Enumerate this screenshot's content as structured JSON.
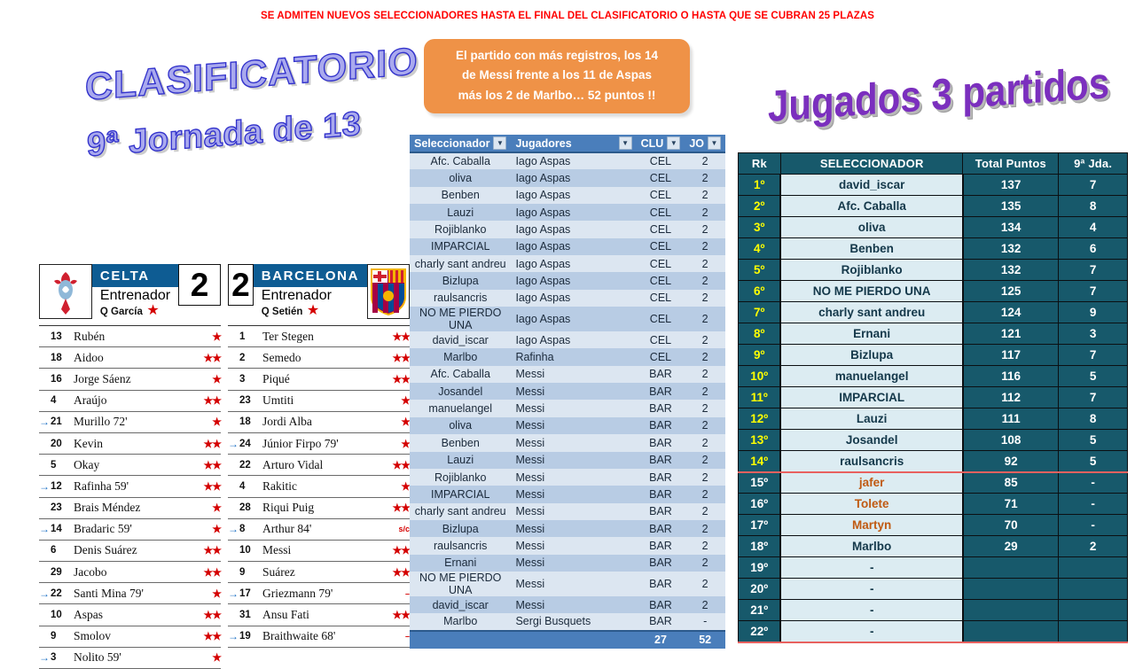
{
  "banner": {
    "text": "SE ADMITEN NUEVOS SELECCIONADORES  HASTA EL FINAL DEL CLASIFICATORIO  O HASTA QUE SE CUBRAN 25 PLAZAS"
  },
  "callout": {
    "line1": "El partido con más registros,  los 14",
    "line2": "de Messi frente a los 11 de Aspas",
    "line3": "más los 2 de Marlbo… 52 puntos !!"
  },
  "titles": {
    "clasificatorio": "CLASIFICATORIO",
    "jornada": "9ª Jornada de 13",
    "jugados": "Jugados 3 partidos"
  },
  "match": {
    "home": {
      "name": "CELTA",
      "score": "2",
      "coach_label": "Entrenador",
      "coach": "Q García",
      "coach_star": "★",
      "crest": "celta-crest"
    },
    "away": {
      "name": "BARCELONA",
      "score": "2",
      "coach_label": "Entrenador",
      "coach": "Q Setién",
      "coach_star": "★",
      "crest": "barcelona-crest"
    },
    "home_players": [
      {
        "sub": "",
        "num": "13",
        "name": "Rubén",
        "rating": "★"
      },
      {
        "sub": "",
        "num": "18",
        "name": "Aidoo",
        "rating": "★★"
      },
      {
        "sub": "",
        "num": "16",
        "name": "Jorge Sáenz",
        "rating": "★"
      },
      {
        "sub": "",
        "num": "4",
        "name": "Araújo",
        "rating": "★★"
      },
      {
        "sub": "→",
        "num": "21",
        "name": "Murillo 72'",
        "rating": "★"
      },
      {
        "sub": "",
        "num": "20",
        "name": "Kevin",
        "rating": "★★"
      },
      {
        "sub": "",
        "num": "5",
        "name": "Okay",
        "rating": "★★"
      },
      {
        "sub": "→",
        "num": "12",
        "name": "Rafinha 59'",
        "rating": "★★"
      },
      {
        "sub": "",
        "num": "23",
        "name": "Brais Méndez",
        "rating": "★"
      },
      {
        "sub": "→",
        "num": "14",
        "name": "Bradaric 59'",
        "rating": "★"
      },
      {
        "sub": "",
        "num": "6",
        "name": "Denis Suárez",
        "rating": "★★"
      },
      {
        "sub": "",
        "num": "29",
        "name": "Jacobo",
        "rating": "★★"
      },
      {
        "sub": "→",
        "num": "22",
        "name": "Santi Mina 79'",
        "rating": "★"
      },
      {
        "sub": "",
        "num": "10",
        "name": "Aspas",
        "rating": "★★"
      },
      {
        "sub": "",
        "num": "9",
        "name": "Smolov",
        "rating": "★★"
      },
      {
        "sub": "→",
        "num": "3",
        "name": "Nolito 59'",
        "rating": "★"
      }
    ],
    "away_players": [
      {
        "sub": "",
        "num": "1",
        "name": "Ter Stegen",
        "rating": "★★"
      },
      {
        "sub": "",
        "num": "2",
        "name": "Semedo",
        "rating": "★★"
      },
      {
        "sub": "",
        "num": "3",
        "name": "Piqué",
        "rating": "★★"
      },
      {
        "sub": "",
        "num": "23",
        "name": "Umtiti",
        "rating": "★"
      },
      {
        "sub": "",
        "num": "18",
        "name": "Jordi Alba",
        "rating": "★"
      },
      {
        "sub": "→",
        "num": "24",
        "name": "Júnior Firpo 79'",
        "rating": "★"
      },
      {
        "sub": "",
        "num": "22",
        "name": "Arturo Vidal",
        "rating": "★★"
      },
      {
        "sub": "",
        "num": "4",
        "name": "Rakitic",
        "rating": "★"
      },
      {
        "sub": "",
        "num": "28",
        "name": "Riqui Puig",
        "rating": "★★"
      },
      {
        "sub": "→",
        "num": "8",
        "name": "Arthur 84'",
        "rating": "s/c"
      },
      {
        "sub": "",
        "num": "10",
        "name": "Messi",
        "rating": "★★"
      },
      {
        "sub": "",
        "num": "9",
        "name": "Suárez",
        "rating": "★★"
      },
      {
        "sub": "→",
        "num": "17",
        "name": "Griezmann 79'",
        "rating": "–"
      },
      {
        "sub": "",
        "num": "31",
        "name": "Ansu Fati",
        "rating": "★★"
      },
      {
        "sub": "→",
        "num": "19",
        "name": "Braithwaite 68'",
        "rating": "–"
      }
    ]
  },
  "picks_table": {
    "headers": [
      "Seleccionador",
      "Jugadores",
      "CLU",
      "JO"
    ],
    "header_icons": [
      "filter-icon",
      "chevron-down-icon",
      "filter-icon",
      "chevron-down-icon"
    ],
    "rows": [
      [
        "Afc. Caballa",
        "Iago Aspas",
        "CEL",
        "2"
      ],
      [
        "oliva",
        "Iago Aspas",
        "CEL",
        "2"
      ],
      [
        "Benben",
        "Iago Aspas",
        "CEL",
        "2"
      ],
      [
        "Lauzi",
        "Iago Aspas",
        "CEL",
        "2"
      ],
      [
        "Rojiblanko",
        "Iago Aspas",
        "CEL",
        "2"
      ],
      [
        "IMPARCIAL",
        "Iago Aspas",
        "CEL",
        "2"
      ],
      [
        "charly sant andreu",
        "Iago Aspas",
        "CEL",
        "2"
      ],
      [
        "Bizlupa",
        "Iago Aspas",
        "CEL",
        "2"
      ],
      [
        "raulsancris",
        "Iago Aspas",
        "CEL",
        "2"
      ],
      [
        "NO ME PIERDO UNA",
        "Iago Aspas",
        "CEL",
        "2"
      ],
      [
        "david_iscar",
        "Iago Aspas",
        "CEL",
        "2"
      ],
      [
        "Marlbo",
        "Rafinha",
        "CEL",
        "2"
      ],
      [
        "Afc. Caballa",
        "Messi",
        "BAR",
        "2"
      ],
      [
        "Josandel",
        "Messi",
        "BAR",
        "2"
      ],
      [
        "manuelangel",
        "Messi",
        "BAR",
        "2"
      ],
      [
        "oliva",
        "Messi",
        "BAR",
        "2"
      ],
      [
        "Benben",
        "Messi",
        "BAR",
        "2"
      ],
      [
        "Lauzi",
        "Messi",
        "BAR",
        "2"
      ],
      [
        "Rojiblanko",
        "Messi",
        "BAR",
        "2"
      ],
      [
        "IMPARCIAL",
        "Messi",
        "BAR",
        "2"
      ],
      [
        "charly sant andreu",
        "Messi",
        "BAR",
        "2"
      ],
      [
        "Bizlupa",
        "Messi",
        "BAR",
        "2"
      ],
      [
        "raulsancris",
        "Messi",
        "BAR",
        "2"
      ],
      [
        "Ernani",
        "Messi",
        "BAR",
        "2"
      ],
      [
        "NO ME PIERDO UNA",
        "Messi",
        "BAR",
        "2"
      ],
      [
        "david_iscar",
        "Messi",
        "BAR",
        "2"
      ],
      [
        "Marlbo",
        "Sergi Busquets",
        "BAR",
        "-"
      ]
    ],
    "totals": [
      "",
      "",
      "27",
      "52"
    ]
  },
  "ranking": {
    "headers": [
      "Rk",
      "SELECCIONADOR",
      "Total Puntos",
      "9ª Jda."
    ],
    "rows": [
      {
        "rk": "1º",
        "name": "david_iscar",
        "total": "137",
        "jda": "7"
      },
      {
        "rk": "2º",
        "name": "Afc. Caballa",
        "total": "135",
        "jda": "8"
      },
      {
        "rk": "3º",
        "name": "oliva",
        "total": "134",
        "jda": "4"
      },
      {
        "rk": "4º",
        "name": "Benben",
        "total": "132",
        "jda": "6"
      },
      {
        "rk": "5º",
        "name": "Rojiblanko",
        "total": "132",
        "jda": "7"
      },
      {
        "rk": "6º",
        "name": "NO ME PIERDO UNA",
        "total": "125",
        "jda": "7"
      },
      {
        "rk": "7º",
        "name": "charly sant andreu",
        "total": "124",
        "jda": "9"
      },
      {
        "rk": "8º",
        "name": "Ernani",
        "total": "121",
        "jda": "3"
      },
      {
        "rk": "9º",
        "name": "Bizlupa",
        "total": "117",
        "jda": "7"
      },
      {
        "rk": "10º",
        "name": "manuelangel",
        "total": "116",
        "jda": "5"
      },
      {
        "rk": "11º",
        "name": "IMPARCIAL",
        "total": "112",
        "jda": "7"
      },
      {
        "rk": "12º",
        "name": "Lauzi",
        "total": "111",
        "jda": "8"
      },
      {
        "rk": "13º",
        "name": "Josandel",
        "total": "108",
        "jda": "5"
      },
      {
        "rk": "14º",
        "name": "raulsancris",
        "total": "92",
        "jda": "5"
      },
      {
        "rk": "15º",
        "name": "jafer",
        "total": "85",
        "jda": "-"
      },
      {
        "rk": "16º",
        "name": "Tolete",
        "total": "71",
        "jda": "-"
      },
      {
        "rk": "17º",
        "name": "Martyn",
        "total": "70",
        "jda": "-"
      },
      {
        "rk": "18º",
        "name": "Marlbo",
        "total": "29",
        "jda": "2"
      },
      {
        "rk": "19º",
        "name": "-",
        "total": "",
        "jda": ""
      },
      {
        "rk": "20º",
        "name": "-",
        "total": "",
        "jda": ""
      },
      {
        "rk": "21º",
        "name": "-",
        "total": "",
        "jda": ""
      },
      {
        "rk": "22º",
        "name": "-",
        "total": "",
        "jda": ""
      }
    ]
  },
  "colors": {
    "banner_red": "#ff0000",
    "callout_orange": "#ef9247",
    "excel_header_blue": "#4a7ebb",
    "excel_row_light": "#dce6f1",
    "excel_row_dark": "#b8cce4",
    "rank_teal": "#17596b",
    "rank_cell_light": "#dcecf2",
    "rank_highlight_yellow": "#ffff00",
    "rank_orange_name": "#c05a12",
    "divider_red": "#e8615f",
    "team_bar_blue": "#0e5c93",
    "star_red": "#d40000",
    "wordart_purple": "#7b2fbe",
    "wordart_blue": "#3333cc"
  }
}
